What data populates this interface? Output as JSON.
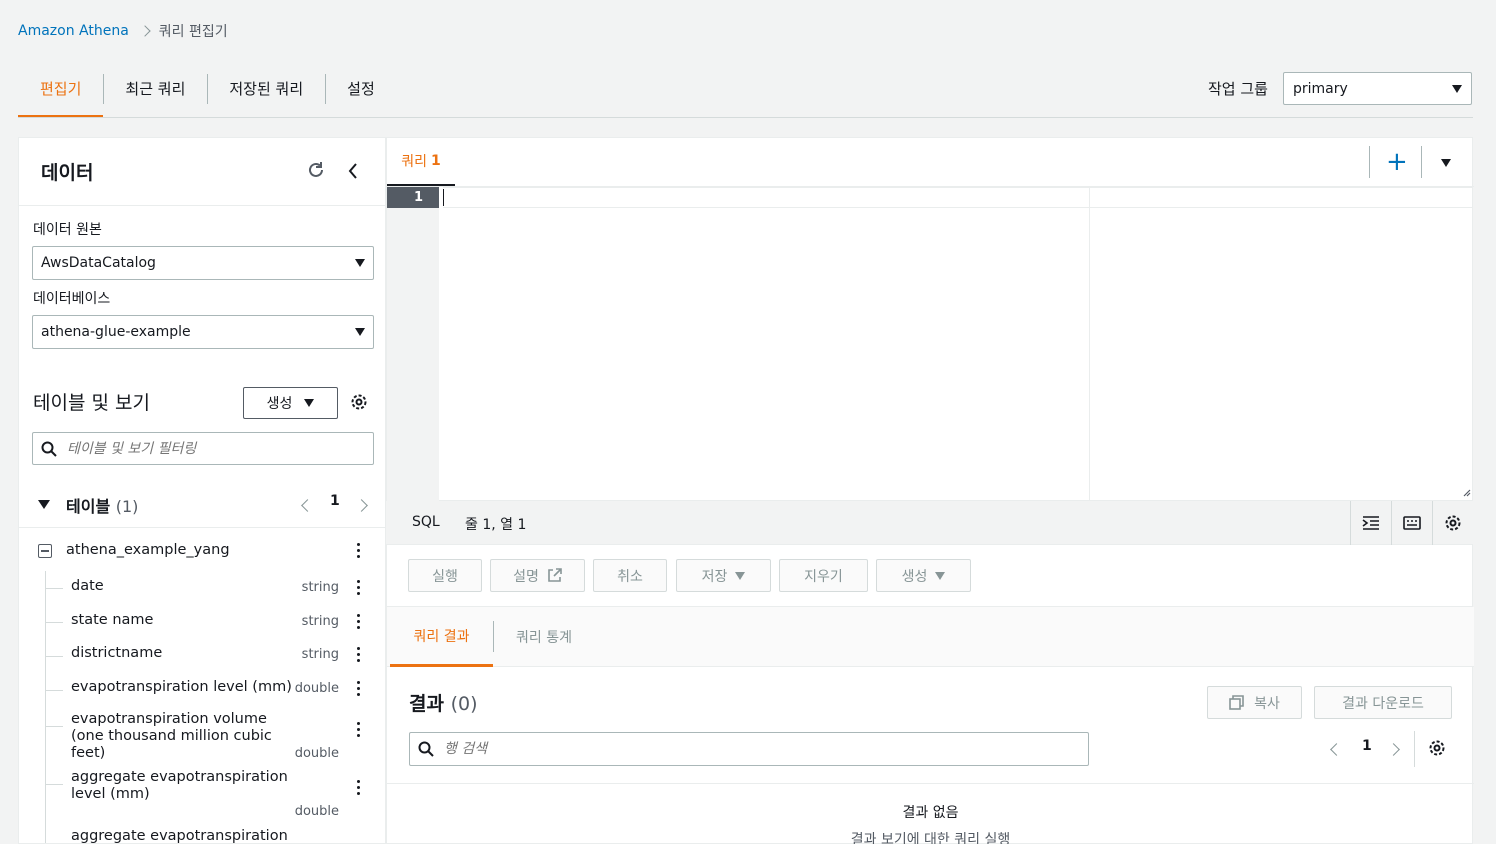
{
  "breadcrumb": {
    "root": "Amazon Athena",
    "current": "쿼리 편집기"
  },
  "top_tabs": [
    {
      "label": "편집기",
      "active": true
    },
    {
      "label": "최근 쿼리",
      "active": false
    },
    {
      "label": "저장된 쿼리",
      "active": false
    },
    {
      "label": "설정",
      "active": false
    }
  ],
  "workgroup": {
    "label": "작업 그룹",
    "value": "primary"
  },
  "left_panel": {
    "title": "데이터",
    "data_source": {
      "label": "데이터 원본",
      "value": "AwsDataCatalog"
    },
    "database": {
      "label": "데이터베이스",
      "value": "athena-glue-example"
    },
    "tables_section": {
      "title": "테이블 및 보기",
      "create_label": "생성",
      "filter_placeholder": "테이블 및 보기 필터링"
    },
    "tables": {
      "label": "테이블",
      "count": "(1)",
      "page": "1"
    },
    "table_name": "athena_example_yang",
    "columns": [
      {
        "name": "date",
        "type": "string"
      },
      {
        "name": "state name",
        "type": "string"
      },
      {
        "name": "districtname",
        "type": "string"
      },
      {
        "name": "evapotranspiration level (mm)",
        "type": "double"
      },
      {
        "name": "evapotranspiration volume (one thousand million cubic feet)",
        "type": "double"
      },
      {
        "name": "aggregate evapotranspiration level (mm)",
        "type": "double"
      },
      {
        "name": "aggregate evapotranspiration volume",
        "type": ""
      }
    ]
  },
  "editor": {
    "tab_label": "쿼리",
    "tab_number": "1",
    "line_number": "1",
    "language": "SQL",
    "cursor_position": "줄 1, 열 1"
  },
  "actions": {
    "run": "실행",
    "explain": "설명",
    "cancel": "취소",
    "save": "저장",
    "clear": "지우기",
    "create": "생성"
  },
  "results": {
    "tab_results": "쿼리 결과",
    "tab_stats": "쿼리 통계",
    "title": "결과",
    "count": "(0)",
    "copy_label": "복사",
    "download_label": "결과 다운로드",
    "search_placeholder": "행 검색",
    "page": "1",
    "empty_title": "결과 없음",
    "empty_subtitle": "결과 보기에 대한 쿼리 실행"
  },
  "colors": {
    "accent": "#ec7211",
    "link": "#0073bb"
  }
}
